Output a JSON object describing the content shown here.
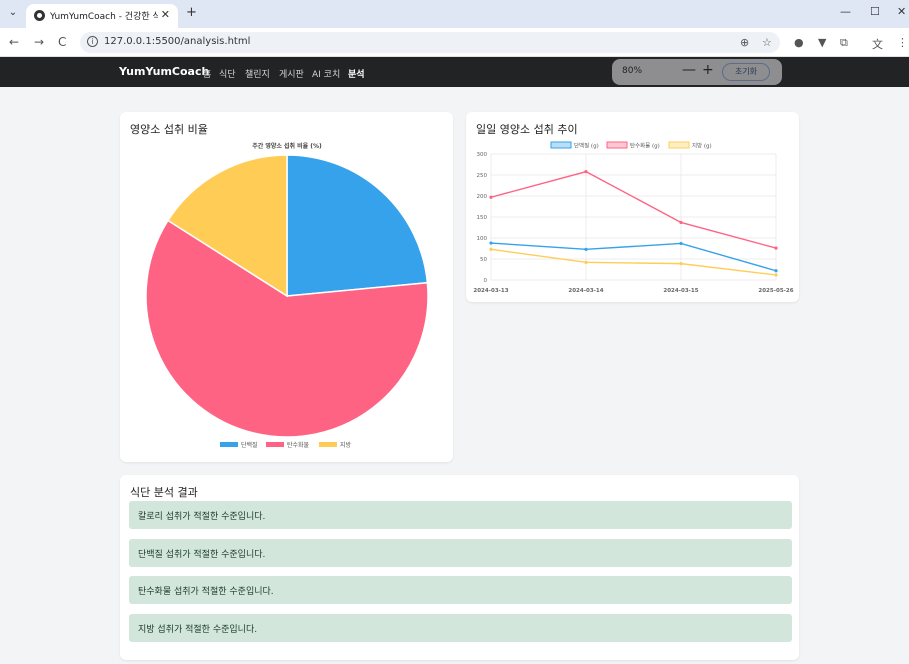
{
  "browser": {
    "tab_title": "YumYumCoach - 건강한 식단 |",
    "url": "127.0.0.1:5500/analysis.html",
    "new_tab": "+",
    "tab_close": "✕",
    "tab_menu": "⌄",
    "back": "←",
    "forward": "→",
    "reload": "C",
    "win_min": "—",
    "win_max": "☐",
    "win_close": "✕"
  },
  "site": {
    "brand": "YumYumCoach",
    "nav": [
      "홈",
      "식단",
      "챌린지",
      "게시판",
      "AI 코치",
      "분석"
    ],
    "active_nav": "분석"
  },
  "zoom": {
    "value": "80%",
    "minus": "—",
    "plus": "+",
    "reset": "초기화"
  },
  "pie_card": {
    "title": "영양소 섭취 비율"
  },
  "line_card": {
    "title": "일일 영양소 섭취 추이"
  },
  "results": {
    "title": "식단 분석 결과",
    "items": [
      "칼로리 섭취가 적절한 수준입니다.",
      "단백질 섭취가 적절한 수준입니다.",
      "탄수화물 섭취가 적절한 수준입니다.",
      "지방 섭취가 적절한 수준입니다."
    ]
  },
  "colors": {
    "protein": "#36a2eb",
    "carb": "#ff6384",
    "fat": "#ffcd56",
    "result_bg": "#d2e6dc"
  },
  "chart_data": [
    {
      "type": "pie",
      "title": "주간 영양소 섭취 비율 (%)",
      "categories": [
        "단백질",
        "탄수화물",
        "지방"
      ],
      "values": [
        23.5,
        60.5,
        16
      ],
      "legend_position": "bottom"
    },
    {
      "type": "line",
      "title": "",
      "x": [
        "2024-03-13",
        "2024-03-14",
        "2024-03-15",
        "2025-05-26"
      ],
      "series": [
        {
          "name": "단백질 (g)",
          "values": [
            88,
            73,
            87,
            22
          ]
        },
        {
          "name": "탄수화물 (g)",
          "values": [
            197,
            258,
            137,
            76
          ]
        },
        {
          "name": "지방 (g)",
          "values": [
            73,
            42,
            39,
            12
          ]
        }
      ],
      "yticks": [
        0,
        50,
        100,
        150,
        200,
        250,
        300
      ],
      "ylim": [
        0,
        300
      ],
      "grid": true,
      "legend_position": "top"
    }
  ]
}
